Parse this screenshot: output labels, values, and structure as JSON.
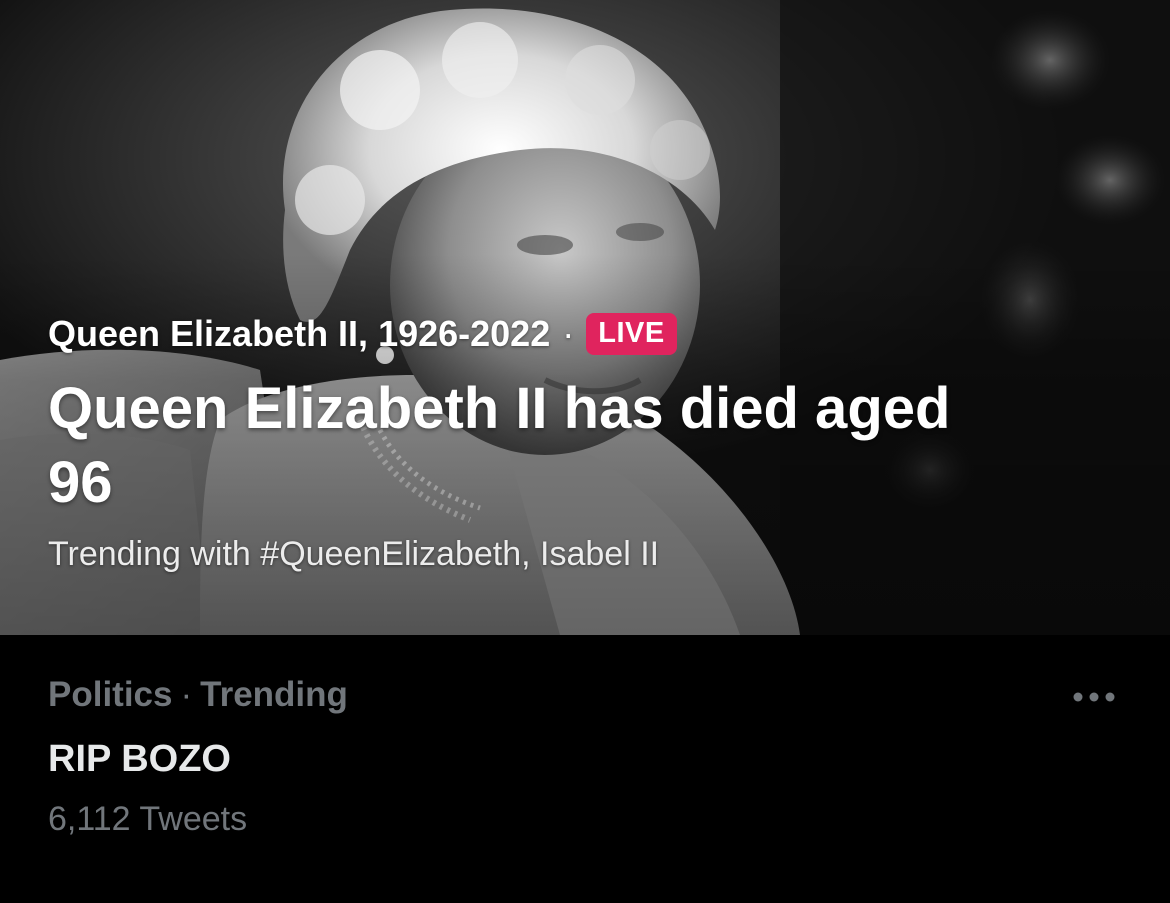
{
  "event": {
    "category": "Queen Elizabeth II, 1926-2022",
    "separator": "·",
    "live_label": "LIVE",
    "title": "Queen Elizabeth II has died aged 96",
    "trending_text": "Trending with #QueenElizabeth, Isabel II",
    "live_color": "#e0245e"
  },
  "trend": {
    "context_category": "Politics",
    "context_separator": "·",
    "context_label": "Trending",
    "title": "RIP BOZO",
    "tweet_count": "6,112 Tweets",
    "more_icon": "more-horizontal-icon"
  },
  "colors": {
    "background": "#000000",
    "primary_text": "#e7e9ea",
    "secondary_text": "#71767b"
  }
}
